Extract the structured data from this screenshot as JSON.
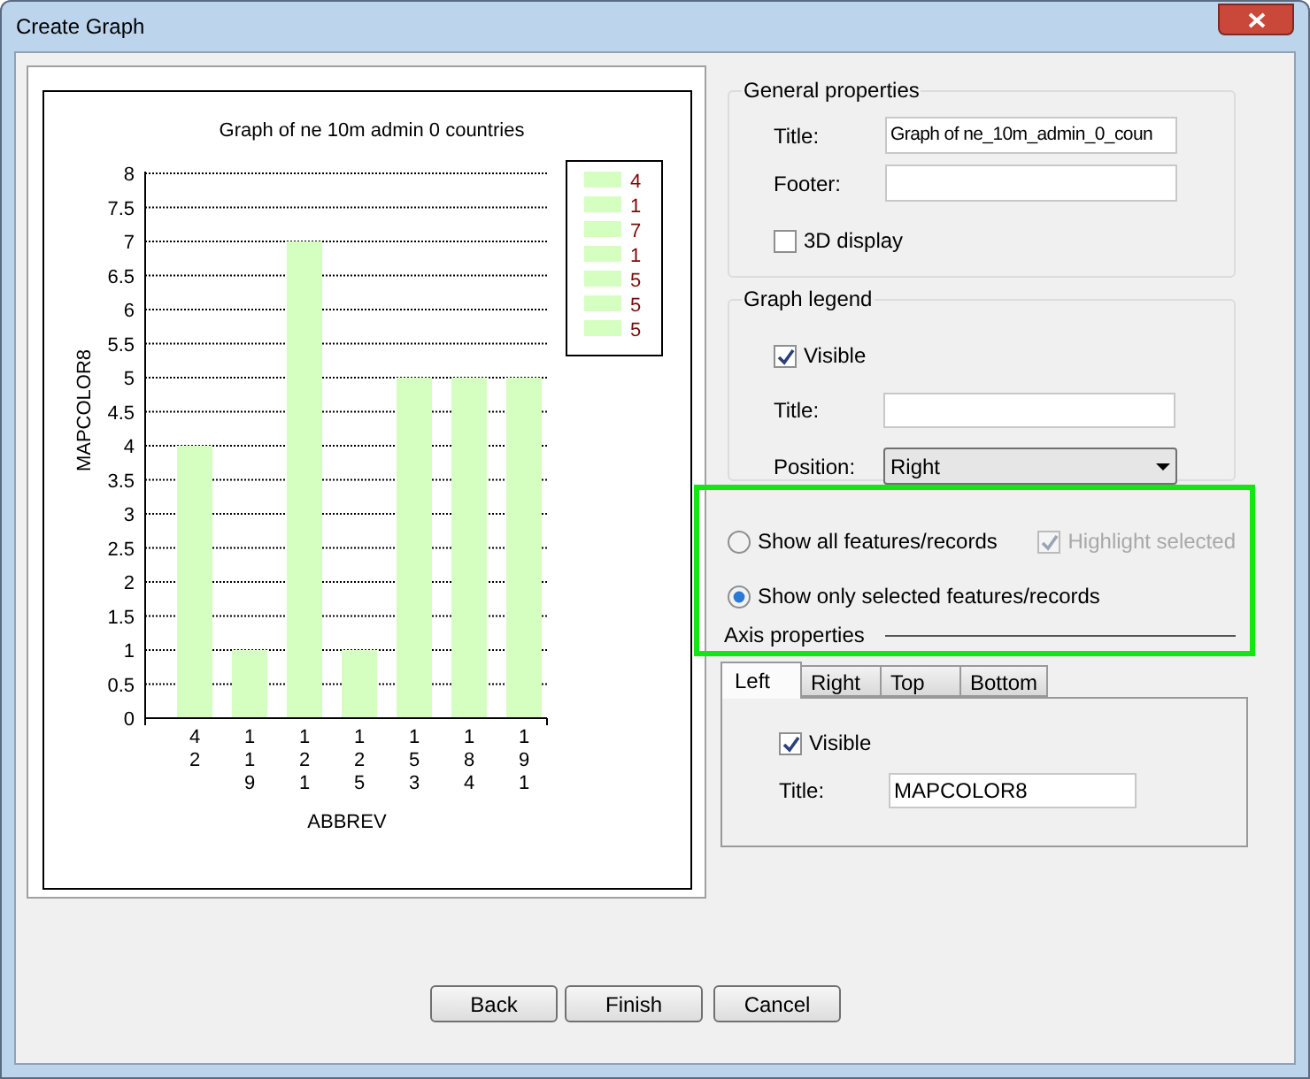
{
  "window": {
    "title": "Create Graph"
  },
  "graph": {
    "chart_data": {
      "type": "bar",
      "title": "Graph of ne  10m  admin  0  countries",
      "xlabel": "ABBREV",
      "ylabel": "MAPCOLOR8",
      "categories": [
        "42",
        "119",
        "121",
        "125",
        "153",
        "184",
        "191"
      ],
      "values": [
        4,
        1,
        7,
        1,
        5,
        5,
        5
      ],
      "grid": true,
      "ylim": [
        0,
        8
      ],
      "yticks": [
        0,
        0.5,
        1,
        1.5,
        2,
        2.5,
        3,
        3.5,
        4,
        4.5,
        5,
        5.5,
        6,
        6.5,
        7,
        7.5,
        8
      ]
    },
    "legend": [
      {
        "label": "4",
        "color": "#d5ffc1"
      },
      {
        "label": "1",
        "color": "#d5ffc1"
      },
      {
        "label": "7",
        "color": "#d5ffc1"
      },
      {
        "label": "1",
        "color": "#d5ffc1"
      },
      {
        "label": "5",
        "color": "#d5ffc1"
      },
      {
        "label": "5",
        "color": "#d5ffc1"
      },
      {
        "label": "5",
        "color": "#d5ffc1"
      }
    ]
  },
  "general_properties": {
    "heading": "General properties",
    "title_label": "Title:",
    "title_value": "Graph of ne_10m_admin_0_coun",
    "footer_label": "Footer:",
    "three_d": {
      "label": "3D display",
      "checked": false
    }
  },
  "graph_legend": {
    "heading": "Graph legend",
    "visible": {
      "label": "Visible",
      "checked": true
    },
    "title_label": "Title:",
    "position_label": "Position:",
    "position_value": "Right"
  },
  "records": {
    "options": [
      {
        "label": "Show all features/records",
        "selected": false
      },
      {
        "label": "Show only selected features/records",
        "selected": true
      }
    ],
    "highlight": {
      "label": "Highlight selected",
      "checked": true,
      "disabled": true
    }
  },
  "axis_properties": {
    "heading": "Axis properties",
    "tabs": [
      {
        "label": "Left",
        "selected": true
      },
      {
        "label": "Right",
        "selected": false
      },
      {
        "label": "Top",
        "selected": false
      },
      {
        "label": "Bottom",
        "selected": false
      }
    ],
    "visible": {
      "label": "Visible",
      "checked": true
    },
    "title_label": "Title:",
    "title_value": "MAPCOLOR8"
  },
  "buttons": [
    "Back",
    "Finish",
    "Cancel"
  ]
}
